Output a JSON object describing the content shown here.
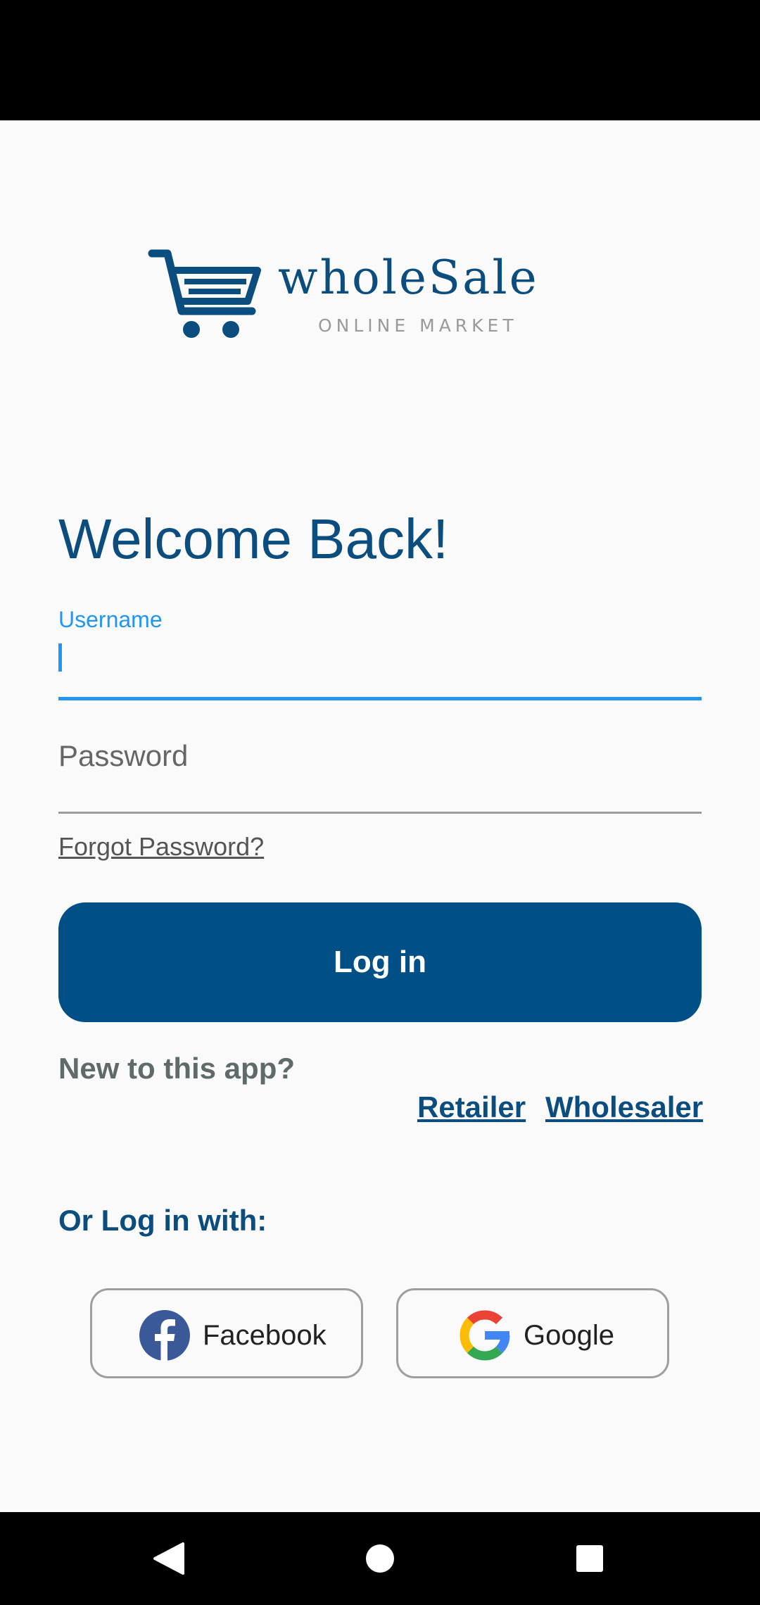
{
  "logo": {
    "wordmark": "wholeSale",
    "tagline": "ONLINE MARKET"
  },
  "heading": "Welcome Back!",
  "username": {
    "label": "Username",
    "value": ""
  },
  "password": {
    "placeholder": "Password"
  },
  "forgot_link": "Forgot Password?",
  "login_button": "Log in",
  "signup": {
    "prompt": "New to this app?",
    "retailer": "Retailer",
    "wholesaler": "Wholesaler"
  },
  "social": {
    "heading": "Or Log in with:",
    "facebook": "Facebook",
    "google": "Google"
  },
  "colors": {
    "brand": "#0b4d7e",
    "button": "#004f87",
    "focus": "#2196f3"
  },
  "icons": {
    "logo": "shopping-cart-icon",
    "facebook": "facebook-icon",
    "google": "google-icon",
    "nav_back": "back-triangle-icon",
    "nav_home": "home-circle-icon",
    "nav_recent": "recent-square-icon"
  }
}
